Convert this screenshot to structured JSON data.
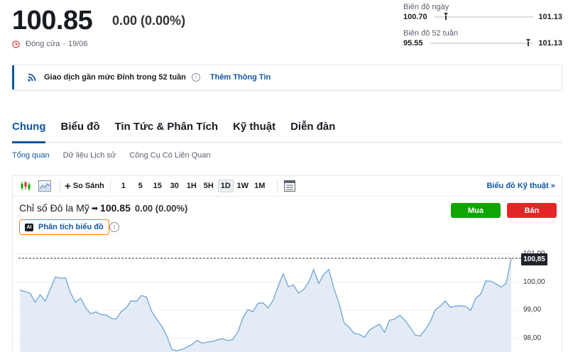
{
  "quote": {
    "price": "100.85",
    "change": "0.00 (0.00%)",
    "status": "Đóng cửa",
    "separator": "·",
    "date": "19/06"
  },
  "day_range": {
    "label": "Biên độ ngày",
    "low": "100.70",
    "high": "101.13",
    "position": 0.12
  },
  "week52_range": {
    "label": "Biên độ 52 tuần",
    "low": "95.55",
    "high": "101.13",
    "position": 0.95
  },
  "notice": {
    "text": "Giao dịch gần mức Đỉnh trong 52 tuần",
    "info_icon": "i",
    "link": "Thêm Thông Tin"
  },
  "tabs": [
    "Chung",
    "Biểu đồ",
    "Tin Tức & Phân Tích",
    "Kỹ thuật",
    "Diễn đàn"
  ],
  "subtabs": [
    "Tổng quan",
    "Dữ liệu Lịch sử",
    "Công Cụ Có Liên Quan"
  ],
  "toolbar": {
    "compare": "So Sánh",
    "timeframes": [
      "1",
      "5",
      "15",
      "30",
      "1H",
      "5H",
      "1D",
      "1W",
      "1M"
    ],
    "active_timeframe": "1D",
    "technical": "Biểu đồ Kỹ thuật »"
  },
  "instrument": {
    "name": "Chỉ số Đô la Mỹ",
    "arrow": "➡",
    "price": "100.85",
    "change": "0.00 (0.00%)"
  },
  "ai_button": {
    "badge": "AI",
    "label": "Phân tích biểu đồ",
    "info_icon": "i"
  },
  "trade": {
    "buy": "Mua",
    "sell": "Bán"
  },
  "chart_data": {
    "type": "area",
    "y_ticks": [
      "101,00",
      "100,00",
      "99,00",
      "98,00"
    ],
    "last_value_label": "100,85",
    "last_value": 100.85,
    "ylim": [
      97.55,
      101.35
    ],
    "values": [
      99.72,
      99.66,
      99.61,
      99.28,
      99.55,
      99.32,
      99.75,
      100.18,
      100.14,
      100.15,
      99.62,
      99.27,
      99.43,
      99.08,
      98.87,
      98.94,
      98.84,
      98.83,
      98.71,
      98.68,
      98.95,
      99.08,
      99.34,
      99.31,
      99.52,
      99.47,
      98.96,
      98.68,
      98.43,
      98.08,
      97.6,
      97.55,
      97.6,
      97.68,
      97.78,
      97.92,
      97.82,
      97.86,
      97.88,
      97.94,
      97.98,
      97.91,
      97.95,
      98.21,
      98.7,
      99.02,
      98.94,
      99.24,
      99.26,
      99.08,
      99.35,
      99.86,
      100.3,
      99.83,
      99.9,
      99.61,
      99.73,
      99.98,
      100.45,
      99.95,
      100.27,
      100.45,
      99.78,
      99.25,
      98.55,
      98.39,
      98.17,
      98.14,
      98.03,
      98.28,
      98.4,
      98.5,
      98.21,
      98.64,
      98.68,
      98.82,
      98.64,
      98.4,
      98.12,
      98.07,
      98.3,
      98.58,
      99.01,
      99.14,
      99.33,
      99.1,
      99.14,
      99.16,
      99.13,
      98.99,
      99.42,
      99.58,
      100.04,
      100.03,
      99.94,
      99.82,
      99.96,
      100.85
    ]
  }
}
